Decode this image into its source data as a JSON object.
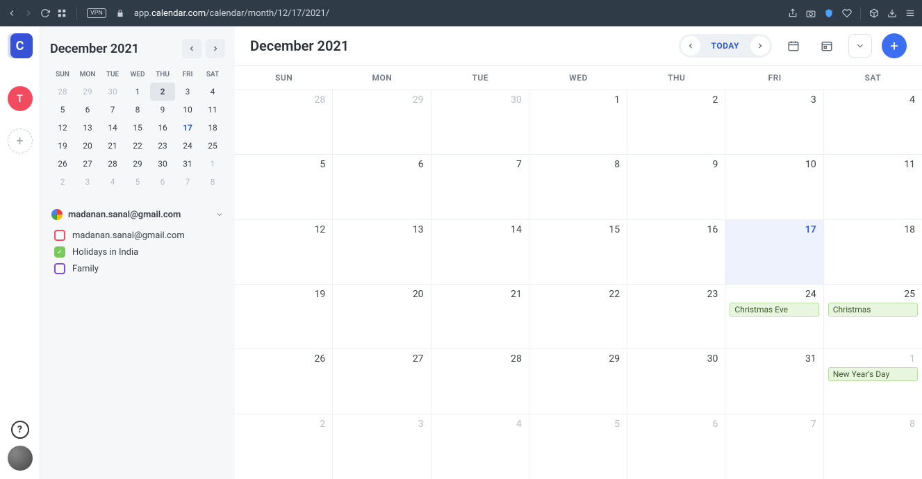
{
  "browser": {
    "url_prefix": "app.",
    "url_domain": "calendar.com",
    "url_path": "/calendar/month/12/17/2021/"
  },
  "rail": {
    "logo_letter": "C",
    "avatar_letter": "T"
  },
  "sidebar": {
    "title": "December 2021",
    "dow": [
      "SUN",
      "MON",
      "TUE",
      "WED",
      "THU",
      "FRI",
      "SAT"
    ],
    "weeks": [
      [
        {
          "n": "28",
          "dim": true
        },
        {
          "n": "29",
          "dim": true
        },
        {
          "n": "30",
          "dim": true
        },
        {
          "n": "1"
        },
        {
          "n": "2",
          "sel": true
        },
        {
          "n": "3"
        },
        {
          "n": "4"
        }
      ],
      [
        {
          "n": "5"
        },
        {
          "n": "6"
        },
        {
          "n": "7"
        },
        {
          "n": "8"
        },
        {
          "n": "9"
        },
        {
          "n": "10"
        },
        {
          "n": "11"
        }
      ],
      [
        {
          "n": "12"
        },
        {
          "n": "13"
        },
        {
          "n": "14"
        },
        {
          "n": "15"
        },
        {
          "n": "16"
        },
        {
          "n": "17",
          "today": true
        },
        {
          "n": "18"
        }
      ],
      [
        {
          "n": "19"
        },
        {
          "n": "20"
        },
        {
          "n": "21"
        },
        {
          "n": "22"
        },
        {
          "n": "23"
        },
        {
          "n": "24"
        },
        {
          "n": "25"
        }
      ],
      [
        {
          "n": "26"
        },
        {
          "n": "27"
        },
        {
          "n": "28"
        },
        {
          "n": "29"
        },
        {
          "n": "30"
        },
        {
          "n": "31"
        },
        {
          "n": "1",
          "dim": true
        }
      ],
      [
        {
          "n": "2",
          "dim": true
        },
        {
          "n": "3",
          "dim": true
        },
        {
          "n": "4",
          "dim": true
        },
        {
          "n": "5",
          "dim": true
        },
        {
          "n": "6",
          "dim": true
        },
        {
          "n": "7",
          "dim": true
        },
        {
          "n": "8",
          "dim": true
        }
      ]
    ],
    "account_email": "madanan.sanal@gmail.com",
    "calendars": [
      {
        "label": "madanan.sanal@gmail.com",
        "color": "#f24a5e",
        "checked": false
      },
      {
        "label": "Holidays in India",
        "color": "#7bc95a",
        "checked": true
      },
      {
        "label": "Family",
        "color": "#7a4fd1",
        "checked": false
      }
    ]
  },
  "main": {
    "title": "December 2021",
    "today_label": "TODAY",
    "dow": [
      "SUN",
      "MON",
      "TUE",
      "WED",
      "THU",
      "FRI",
      "SAT"
    ],
    "rows": [
      [
        {
          "n": "28",
          "out": true
        },
        {
          "n": "29",
          "out": true
        },
        {
          "n": "30",
          "out": true
        },
        {
          "n": "1"
        },
        {
          "n": "2"
        },
        {
          "n": "3"
        },
        {
          "n": "4"
        }
      ],
      [
        {
          "n": "5"
        },
        {
          "n": "6"
        },
        {
          "n": "7"
        },
        {
          "n": "8"
        },
        {
          "n": "9"
        },
        {
          "n": "10"
        },
        {
          "n": "11"
        }
      ],
      [
        {
          "n": "12"
        },
        {
          "n": "13"
        },
        {
          "n": "14"
        },
        {
          "n": "15"
        },
        {
          "n": "16"
        },
        {
          "n": "17",
          "today": true
        },
        {
          "n": "18"
        }
      ],
      [
        {
          "n": "19"
        },
        {
          "n": "20"
        },
        {
          "n": "21"
        },
        {
          "n": "22"
        },
        {
          "n": "23"
        },
        {
          "n": "24",
          "events": [
            "Christmas Eve"
          ]
        },
        {
          "n": "25",
          "events": [
            "Christmas"
          ]
        }
      ],
      [
        {
          "n": "26"
        },
        {
          "n": "27"
        },
        {
          "n": "28"
        },
        {
          "n": "29"
        },
        {
          "n": "30"
        },
        {
          "n": "31"
        },
        {
          "n": "1",
          "out": true,
          "events": [
            "New Year's Day"
          ]
        }
      ],
      [
        {
          "n": "2",
          "out": true
        },
        {
          "n": "3",
          "out": true
        },
        {
          "n": "4",
          "out": true
        },
        {
          "n": "5",
          "out": true
        },
        {
          "n": "6",
          "out": true
        },
        {
          "n": "7",
          "out": true
        },
        {
          "n": "8",
          "out": true
        }
      ]
    ]
  }
}
